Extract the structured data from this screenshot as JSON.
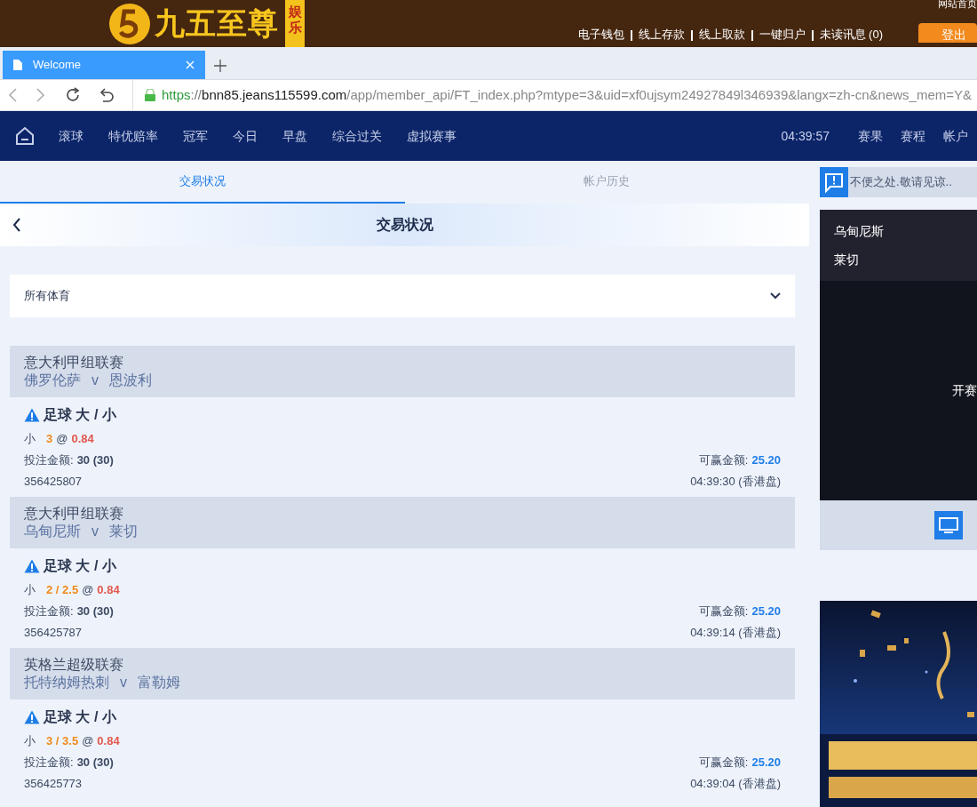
{
  "banner": {
    "logo_text": "九五至尊",
    "side_text": "娱乐",
    "top_link": "网站首页",
    "links": [
      "电子钱包",
      "线上存款",
      "线上取款",
      "一键归户",
      "未读讯息 (0)"
    ],
    "logout": "登出"
  },
  "browser": {
    "tab_title": "Welcome",
    "url_scheme": "https",
    "url_separator": "://",
    "url_host": "bnn85.jeans115599.com",
    "url_path": "/app/member_api/FT_index.php?mtype=3&uid=xf0ujsym24927849l346939&langx=zh-cn&news_mem=Y&"
  },
  "nav": {
    "items": [
      "滚球",
      "特优赔率",
      "冠军",
      "今日",
      "早盘",
      "综合过关",
      "虚拟赛事"
    ],
    "time": "04:39:57",
    "right_items": [
      "赛果",
      "赛程",
      "帐户"
    ]
  },
  "tabs": [
    {
      "label": "交易状况",
      "selected": true
    },
    {
      "label": "帐户历史",
      "selected": false
    }
  ],
  "header": {
    "title": "交易状况"
  },
  "filter": {
    "value": "所有体育"
  },
  "bets": [
    {
      "league": "意大利甲组联赛",
      "home": "佛罗伦萨",
      "vs": "v",
      "away": "恩波利",
      "market": "足球 大 / 小",
      "pick": "小",
      "line": "3",
      "at": "@",
      "odds": "0.84",
      "stake_label": "投注金额:",
      "stake": "30 (30)",
      "win_label": "可赢金额:",
      "win": "25.20",
      "id": "356425807",
      "time": "04:39:30 (香港盘)"
    },
    {
      "league": "意大利甲组联赛",
      "home": "乌甸尼斯",
      "vs": "v",
      "away": "莱切",
      "market": "足球 大 / 小",
      "pick": "小",
      "line": "2 / 2.5",
      "at": "@",
      "odds": "0.84",
      "stake_label": "投注金额:",
      "stake": "30 (30)",
      "win_label": "可赢金额:",
      "win": "25.20",
      "id": "356425787",
      "time": "04:39:14 (香港盘)"
    },
    {
      "league": "英格兰超级联赛",
      "home": "托特纳姆热刺",
      "vs": "v",
      "away": "富勒姆",
      "market": "足球 大 / 小",
      "pick": "小",
      "line": "3 / 3.5",
      "at": "@",
      "odds": "0.84",
      "stake_label": "投注金额:",
      "stake": "30 (30)",
      "win_label": "可赢金额:",
      "win": "25.20",
      "id": "356425773",
      "time": "04:39:04 (香港盘)"
    }
  ],
  "side": {
    "notice": "不便之处.敬请见谅..",
    "teams": [
      "乌甸尼斯",
      "莱切"
    ],
    "status": "开赛"
  }
}
